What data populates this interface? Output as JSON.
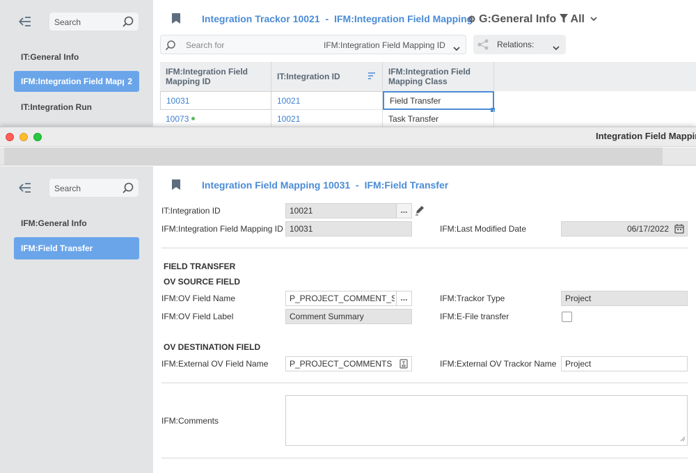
{
  "back_window": {
    "sidebar": {
      "search_placeholder": "Search",
      "items": [
        {
          "label": "IT:General Info"
        },
        {
          "label": "IFM:Integration Field Mapping ID",
          "badge": "2"
        },
        {
          "label": "IT:Integration Run"
        }
      ]
    },
    "header": {
      "title": "Integration Trackor 10021",
      "separator": "-",
      "subtitle": "IFM:Integration Field Mapping",
      "tab_label": "G:General Info",
      "filter_label": "All"
    },
    "search": {
      "placeholder": "Search for",
      "field_select": "IFM:Integration Field Mapping ID",
      "relations_label": "Relations:"
    },
    "grid": {
      "columns": [
        "IFM:Integration Field Mapping ID",
        "IT:Integration ID",
        "IFM:Integration Field Mapping Class"
      ],
      "rows": [
        {
          "id": "10031",
          "integration_id": "10021",
          "class": "Field Transfer"
        },
        {
          "id": "10073",
          "integration_id": "10021",
          "class": "Task Transfer"
        }
      ]
    }
  },
  "front_window": {
    "title": "Integration Field Mapping",
    "sidebar": {
      "search_placeholder": "Search",
      "items": [
        {
          "label": "IFM:General Info"
        },
        {
          "label": "IFM:Field Transfer"
        }
      ]
    },
    "header": {
      "title": "Integration Field Mapping 10031",
      "separator": "-",
      "subtitle": "IFM:Field Transfer"
    },
    "fields": {
      "integration_id": {
        "label": "IT:Integration ID",
        "value": "10021"
      },
      "mapping_id": {
        "label": "IFM:Integration Field Mapping ID",
        "value": "10031"
      },
      "last_modified": {
        "label": "IFM:Last Modified Date",
        "value": "06/17/2022"
      },
      "ov_field_name": {
        "label": "IFM:OV Field Name",
        "value": "P_PROJECT_COMMENT_SUMMARY"
      },
      "ov_field_label": {
        "label": "IFM:OV Field Label",
        "value": "Comment Summary"
      },
      "trackor_type": {
        "label": "IFM:Trackor Type",
        "value": "Project"
      },
      "efile_transfer": {
        "label": "IFM:E-File transfer",
        "checked": false
      },
      "ext_field_name": {
        "label": "IFM:External OV Field Name",
        "value": "P_PROJECT_COMMENTS"
      },
      "ext_trackor_name": {
        "label": "IFM:External OV Trackor Name",
        "value": "Project"
      },
      "comments": {
        "label": "IFM:Comments",
        "value": ""
      }
    },
    "sections": {
      "field_transfer": "FIELD TRANSFER",
      "ov_source": "OV SOURCE FIELD",
      "ov_destination": "OV DESTINATION FIELD"
    },
    "ellipsis": "...",
    "colors": {
      "accent": "#4a8bd6",
      "active_bg": "#6aa5ea",
      "sidebar_bg": "#e2e4e6"
    }
  }
}
